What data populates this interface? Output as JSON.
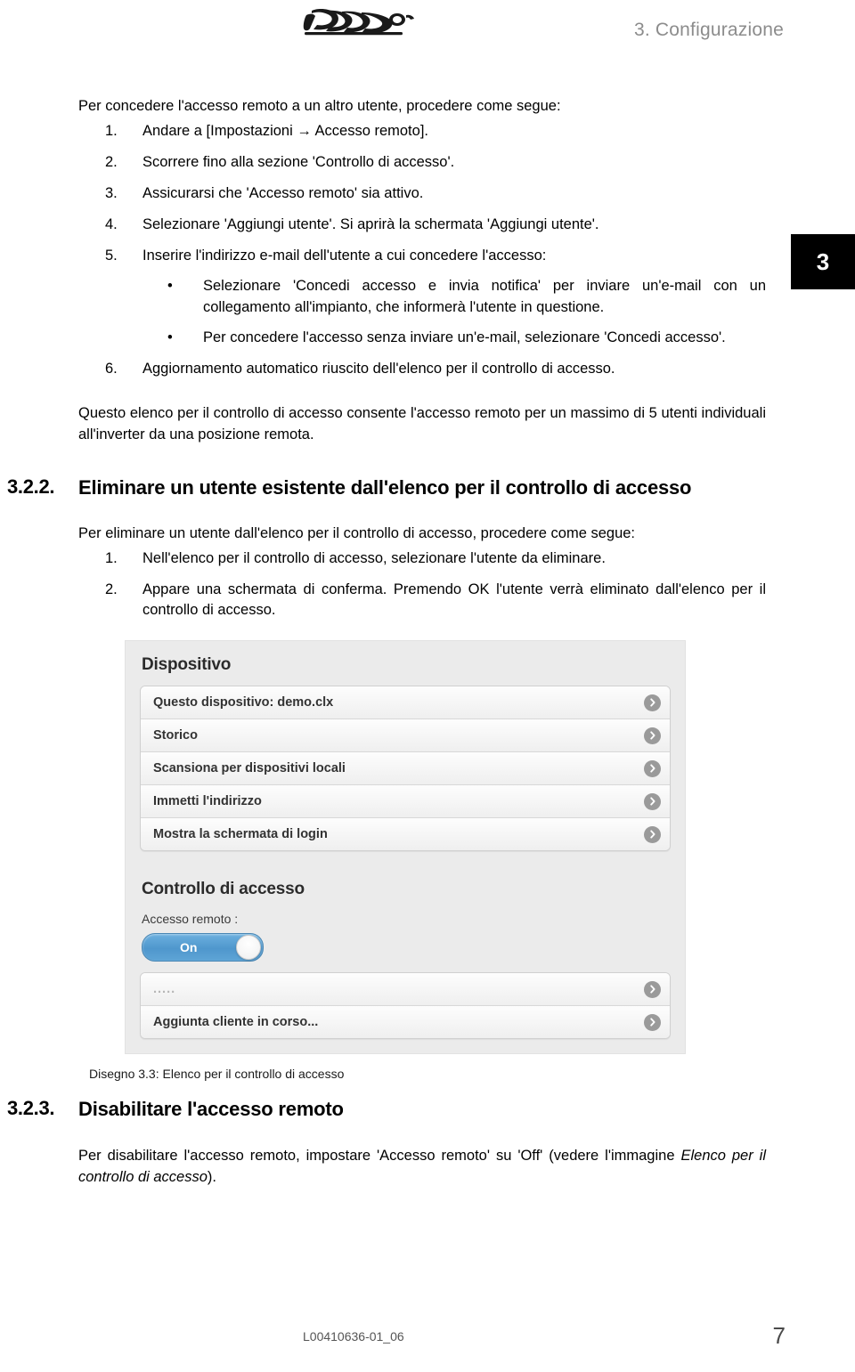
{
  "header": {
    "brand": "Danfoss",
    "chapter_title": "3. Configurazione",
    "chapter_tab": "3"
  },
  "intro": {
    "lead": "Per concedere l'accesso remoto a un altro utente, procedere come segue:"
  },
  "steps_grant": [
    {
      "num": "1.",
      "text": "Andare a [Impostazioni → Accesso remoto]."
    },
    {
      "num": "2.",
      "text": "Scorrere fino alla sezione 'Controllo di accesso'."
    },
    {
      "num": "3.",
      "text": "Assicurarsi che 'Accesso remoto' sia attivo."
    },
    {
      "num": "4.",
      "text": "Selezionare 'Aggiungi utente'. Si aprirà la schermata 'Aggiungi utente'."
    },
    {
      "num": "5.",
      "text": "Inserire l'indirizzo e-mail dell'utente a cui concedere l'accesso:"
    },
    {
      "num": "6.",
      "text": "Aggiornamento automatico riuscito dell'elenco per il controllo di accesso."
    }
  ],
  "bullets_step5": [
    {
      "dot": "•",
      "text": "Selezionare 'Concedi accesso e invia notifica' per inviare un'e-mail con un collegamento all'impianto, che informerà l'utente in questione."
    },
    {
      "dot": "•",
      "text": "Per concedere l'accesso senza inviare un'e-mail, selezionare 'Concedi accesso'."
    }
  ],
  "paragraph_limit": "Questo elenco per il controllo di accesso consente l'accesso remoto per un massimo di 5 utenti individuali all'inverter da una posizione remota.",
  "section_322": {
    "number": "3.2.2.",
    "title": "Eliminare un utente esistente dall'elenco per il controllo di accesso",
    "lead": "Per eliminare un utente dall'elenco per il controllo di accesso, procedere come segue:",
    "steps": [
      {
        "num": "1.",
        "text": "Nell'elenco per il controllo di accesso, selezionare l'utente da eliminare."
      },
      {
        "num": "2.",
        "text": "Appare una schermata di conferma. Premendo OK l'utente verrà eliminato dall'elenco per il controllo di accesso."
      }
    ]
  },
  "figure": {
    "device_section_title": "Dispositivo",
    "device_rows": [
      {
        "label": "Questo dispositivo: demo.clx",
        "icon": "chevron-right-icon"
      },
      {
        "label": "Storico",
        "icon": "chevron-right-icon"
      },
      {
        "label": "Scansiona per dispositivi locali",
        "icon": "chevron-right-icon"
      },
      {
        "label": "Immetti l'indirizzo",
        "icon": "chevron-right-icon"
      },
      {
        "label": "Mostra la schermata di login",
        "icon": "chevron-right-icon"
      }
    ],
    "access_section_title": "Controllo di accesso",
    "access_label": "Accesso remoto :",
    "toggle_state": "On",
    "access_rows": [
      {
        "label": ".....",
        "muted": true,
        "icon": "chevron-right-icon"
      },
      {
        "label": "Aggiunta cliente in corso...",
        "muted": false,
        "icon": "chevron-right-icon"
      }
    ],
    "caption": "Disegno 3.3: Elenco per il controllo di accesso",
    "colors": {
      "toggle_on": "#5ea4d6",
      "panel_bg": "#ebebeb",
      "chevron_circle": "#9a9a9a"
    }
  },
  "section_323": {
    "number": "3.2.3.",
    "title": "Disabilitare l'accesso remoto",
    "body_prefix": "Per disabilitare l'accesso remoto, impostare 'Accesso remoto' su 'Off' (vedere l'immagine ",
    "body_italic": "Elenco per il controllo di accesso",
    "body_suffix": ")."
  },
  "footer": {
    "doc_code": "L00410636-01_06",
    "page_number": "7"
  }
}
